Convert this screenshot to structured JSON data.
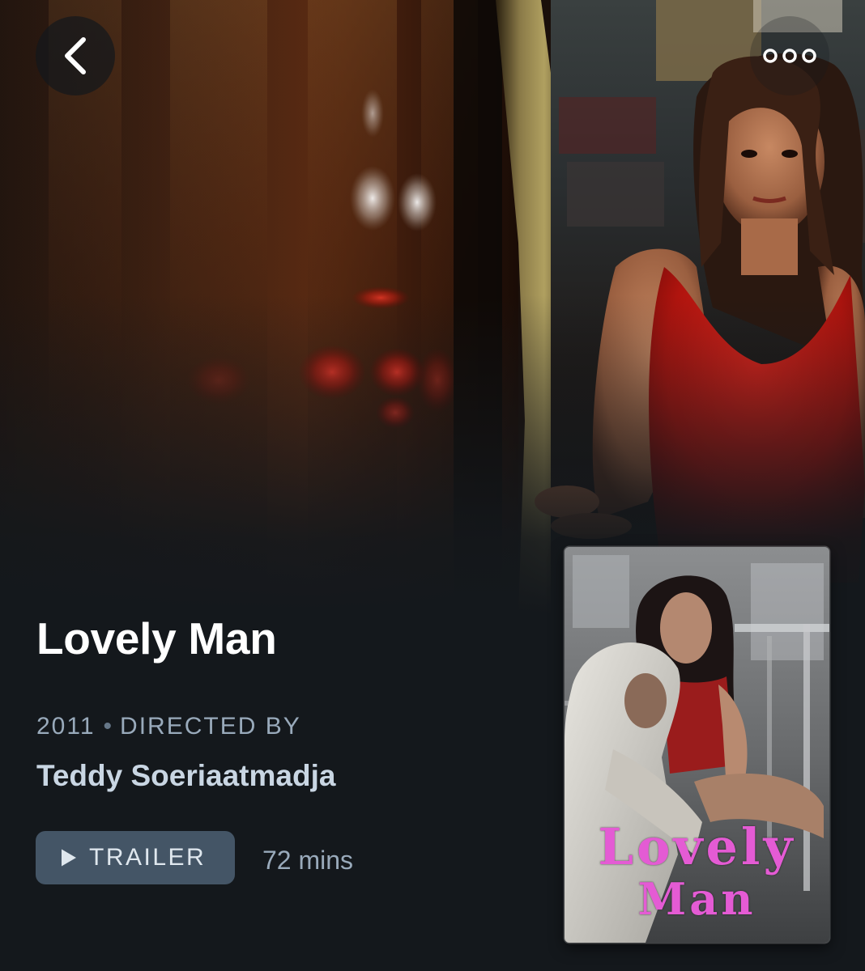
{
  "film": {
    "title": "Lovely Man",
    "year": "2011",
    "separator": "•",
    "directed_by_label": "DIRECTED BY",
    "director": "Teddy Soeriaatmadja",
    "runtime": "72 mins"
  },
  "actions": {
    "trailer_label": "TRAILER"
  },
  "poster": {
    "title_line1": "Lovely",
    "title_line2": "Man"
  },
  "icons": {
    "back": "chevron-left-icon",
    "more": "more-dots-icon",
    "play": "play-icon"
  },
  "colors": {
    "background": "#14181c",
    "title": "#ffffff",
    "meta": "#99aabb",
    "director": "#c9d6e3",
    "trailer_button": "#445566",
    "poster_title": "#e45bd4"
  }
}
